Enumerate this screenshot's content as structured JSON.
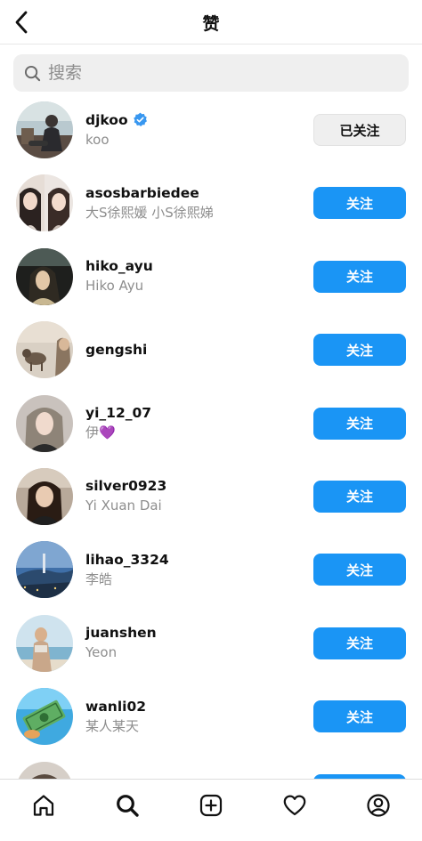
{
  "header": {
    "title": "赞",
    "back_icon": "chevron-left-icon"
  },
  "search": {
    "placeholder": "搜索",
    "icon": "search-icon"
  },
  "colors": {
    "follow_button": "#1a95f5",
    "following_button": "#efefef",
    "verified_badge": "#3897f0",
    "secondary_text": "#8e8e8e"
  },
  "users": [
    {
      "username": "djkoo",
      "full_name": "koo",
      "verified": true,
      "button": "已关注",
      "state": "following"
    },
    {
      "username": "asosbarbiedee",
      "full_name": "大S徐熙媛 小S徐熙娣",
      "verified": false,
      "button": "关注",
      "state": "follow"
    },
    {
      "username": "hiko_ayu",
      "full_name": "Hiko Ayu",
      "verified": false,
      "button": "关注",
      "state": "follow"
    },
    {
      "username": "gengshi",
      "full_name": "",
      "verified": false,
      "button": "关注",
      "state": "follow"
    },
    {
      "username": "yi_12_07",
      "full_name": "伊💜",
      "verified": false,
      "button": "关注",
      "state": "follow"
    },
    {
      "username": "silver0923",
      "full_name": "Yi Xuan Dai",
      "verified": false,
      "button": "关注",
      "state": "follow"
    },
    {
      "username": "lihao_3324",
      "full_name": "李皓",
      "verified": false,
      "button": "关注",
      "state": "follow"
    },
    {
      "username": "juanshen",
      "full_name": "Yeon",
      "verified": false,
      "button": "关注",
      "state": "follow"
    },
    {
      "username": "wanli02",
      "full_name": "某人某天",
      "verified": false,
      "button": "关注",
      "state": "follow"
    }
  ],
  "tabbar": {
    "items": [
      "home-icon",
      "search-icon",
      "new-post-icon",
      "heart-icon",
      "profile-icon"
    ],
    "active": "search-icon"
  }
}
